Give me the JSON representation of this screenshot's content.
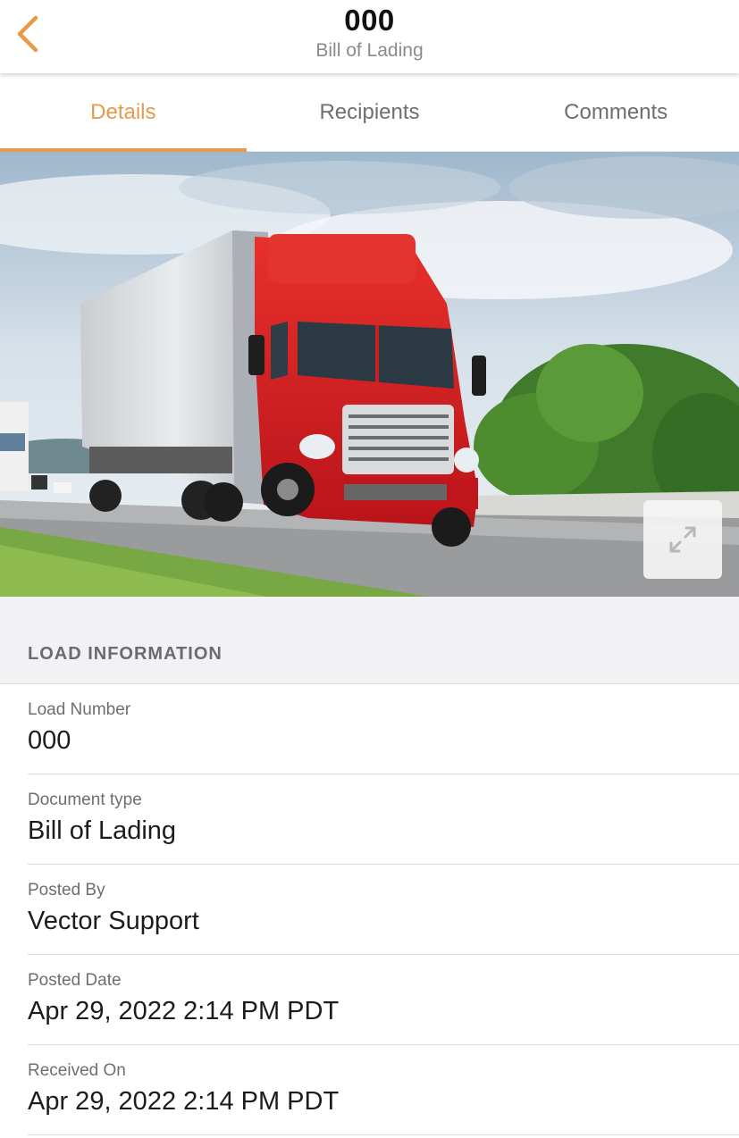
{
  "header": {
    "title": "000",
    "subtitle": "Bill of Lading",
    "back_icon": "chevron-left-icon",
    "accent_color": "#e59b4a"
  },
  "tabs": [
    {
      "label": "Details",
      "active": true
    },
    {
      "label": "Recipients",
      "active": false
    },
    {
      "label": "Comments",
      "active": false
    }
  ],
  "hero": {
    "image": "red semi-truck with white trailer on highway",
    "expand_icon": "expand-icon"
  },
  "section": {
    "title": "LOAD INFORMATION"
  },
  "fields": [
    {
      "label": "Load Number",
      "value": "000"
    },
    {
      "label": "Document type",
      "value": "Bill of Lading"
    },
    {
      "label": "Posted By",
      "value": "Vector Support"
    },
    {
      "label": "Posted Date",
      "value": "Apr 29, 2022 2:14 PM PDT"
    },
    {
      "label": "Received On",
      "value": "Apr 29, 2022 2:14 PM PDT"
    }
  ]
}
